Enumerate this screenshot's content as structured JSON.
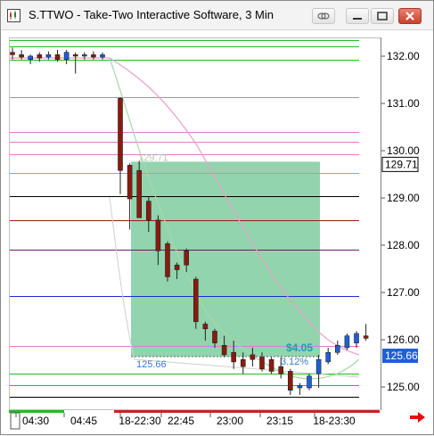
{
  "window": {
    "title": "S.TTWO - Take-Two Interactive Software, 3 Min",
    "buttons": [
      "link-icon",
      "minimize-icon",
      "maximize-icon",
      "close-icon"
    ]
  },
  "price_axis": {
    "ticks": [
      "132.00",
      "131.00",
      "130.00",
      "129.00",
      "128.00",
      "127.00",
      "126.00",
      "125.00"
    ],
    "last_price_label": "129.71",
    "current_price_label": "125.66"
  },
  "time_axis": {
    "ticks": [
      "04:30",
      "04:45",
      "18-22:30",
      "22:45",
      "23:00",
      "23:15",
      "18-23:30"
    ]
  },
  "measure_tool": {
    "start_price": "129.71",
    "end_price": "125.66",
    "dollar_change": "$4.05",
    "percent_change": "3.12%"
  },
  "colors": {
    "up_candle": "#1f5fd6",
    "down_candle": "#8b1a0e",
    "measure_fill": "#7fcc9f",
    "green_level": "#22bb22",
    "pink_level": "#e07ad0",
    "blue_level": "#1a2bd6",
    "dark_red_level": "#9b1d14",
    "black_level": "#000000",
    "gray_level": "#9a9a9a",
    "purple_level": "#6a1a6a",
    "arrow": "#e01010"
  },
  "chart_data": {
    "type": "candlestick",
    "symbol": "S.TTWO",
    "interval": "3 Min",
    "y_range": [
      124.75,
      132.35
    ],
    "candles": [
      {
        "o": 132.1,
        "h": 132.2,
        "l": 131.95,
        "c": 132.05
      },
      {
        "o": 132.05,
        "h": 132.15,
        "l": 131.95,
        "c": 132.0
      },
      {
        "o": 131.95,
        "h": 132.05,
        "l": 131.85,
        "c": 132.02
      },
      {
        "o": 132.05,
        "h": 132.1,
        "l": 131.9,
        "c": 131.98
      },
      {
        "o": 132.0,
        "h": 132.12,
        "l": 131.95,
        "c": 132.05
      },
      {
        "o": 132.05,
        "h": 132.15,
        "l": 131.9,
        "c": 131.95
      },
      {
        "o": 131.95,
        "h": 132.15,
        "l": 131.85,
        "c": 132.1
      },
      {
        "o": 132.05,
        "h": 132.1,
        "l": 131.65,
        "c": 132.02
      },
      {
        "o": 132.02,
        "h": 132.1,
        "l": 131.95,
        "c": 132.05
      },
      {
        "o": 132.05,
        "h": 132.12,
        "l": 131.95,
        "c": 132.0
      },
      {
        "o": 132.0,
        "h": 132.1,
        "l": 131.95,
        "c": 132.05
      },
      {
        "o": 131.13,
        "h": 131.15,
        "l": 129.1,
        "c": 129.6
      },
      {
        "o": 129.71,
        "h": 129.75,
        "l": 128.35,
        "c": 129.0
      },
      {
        "o": 129.6,
        "h": 129.8,
        "l": 128.7,
        "c": 128.6
      },
      {
        "o": 128.95,
        "h": 129.05,
        "l": 128.3,
        "c": 128.55
      },
      {
        "o": 128.55,
        "h": 128.65,
        "l": 127.6,
        "c": 127.9
      },
      {
        "o": 128.05,
        "h": 128.1,
        "l": 127.25,
        "c": 127.35
      },
      {
        "o": 127.6,
        "h": 127.65,
        "l": 127.3,
        "c": 127.5
      },
      {
        "o": 127.9,
        "h": 127.95,
        "l": 127.45,
        "c": 127.6
      },
      {
        "o": 127.3,
        "h": 127.35,
        "l": 126.25,
        "c": 126.4
      },
      {
        "o": 126.35,
        "h": 126.4,
        "l": 126.0,
        "c": 126.25
      },
      {
        "o": 126.2,
        "h": 126.25,
        "l": 125.85,
        "c": 125.95
      },
      {
        "o": 125.9,
        "h": 126.1,
        "l": 125.65,
        "c": 125.7
      },
      {
        "o": 125.75,
        "h": 126.0,
        "l": 125.4,
        "c": 125.55
      },
      {
        "o": 125.6,
        "h": 125.75,
        "l": 125.3,
        "c": 125.45
      },
      {
        "o": 125.7,
        "h": 125.85,
        "l": 125.45,
        "c": 125.6
      },
      {
        "o": 125.65,
        "h": 125.75,
        "l": 125.35,
        "c": 125.4
      },
      {
        "o": 125.6,
        "h": 125.65,
        "l": 125.3,
        "c": 125.35
      },
      {
        "o": 125.45,
        "h": 125.65,
        "l": 125.2,
        "c": 125.3
      },
      {
        "o": 125.35,
        "h": 125.4,
        "l": 124.85,
        "c": 124.95
      },
      {
        "o": 125.0,
        "h": 125.1,
        "l": 124.85,
        "c": 125.05
      },
      {
        "o": 125.0,
        "h": 125.3,
        "l": 124.95,
        "c": 125.25
      },
      {
        "o": 125.3,
        "h": 125.7,
        "l": 125.0,
        "c": 125.6
      },
      {
        "o": 125.55,
        "h": 125.85,
        "l": 125.5,
        "c": 125.75
      },
      {
        "o": 125.75,
        "h": 126.0,
        "l": 125.7,
        "c": 125.9
      },
      {
        "o": 125.85,
        "h": 126.15,
        "l": 125.8,
        "c": 126.1
      },
      {
        "o": 125.95,
        "h": 126.2,
        "l": 125.85,
        "c": 126.15
      },
      {
        "o": 126.1,
        "h": 126.35,
        "l": 126.0,
        "c": 126.05
      }
    ],
    "levels": [
      {
        "price": 132.35,
        "color": "green"
      },
      {
        "price": 132.22,
        "color": "green"
      },
      {
        "price": 131.95,
        "color": "green"
      },
      {
        "price": 131.15,
        "color": "gray"
      },
      {
        "price": 130.42,
        "color": "pink"
      },
      {
        "price": 130.2,
        "color": "pink"
      },
      {
        "price": 129.95,
        "color": "pink"
      },
      {
        "price": 129.55,
        "color": "pink"
      },
      {
        "price": 129.05,
        "color": "black"
      },
      {
        "price": 128.55,
        "color": "dark_red"
      },
      {
        "price": 127.92,
        "color": "purple"
      },
      {
        "price": 126.95,
        "color": "blue"
      },
      {
        "price": 125.88,
        "color": "pink"
      },
      {
        "price": 125.3,
        "color": "green"
      },
      {
        "price": 125.05,
        "color": "green"
      },
      {
        "price": 124.82,
        "color": "black"
      }
    ]
  }
}
